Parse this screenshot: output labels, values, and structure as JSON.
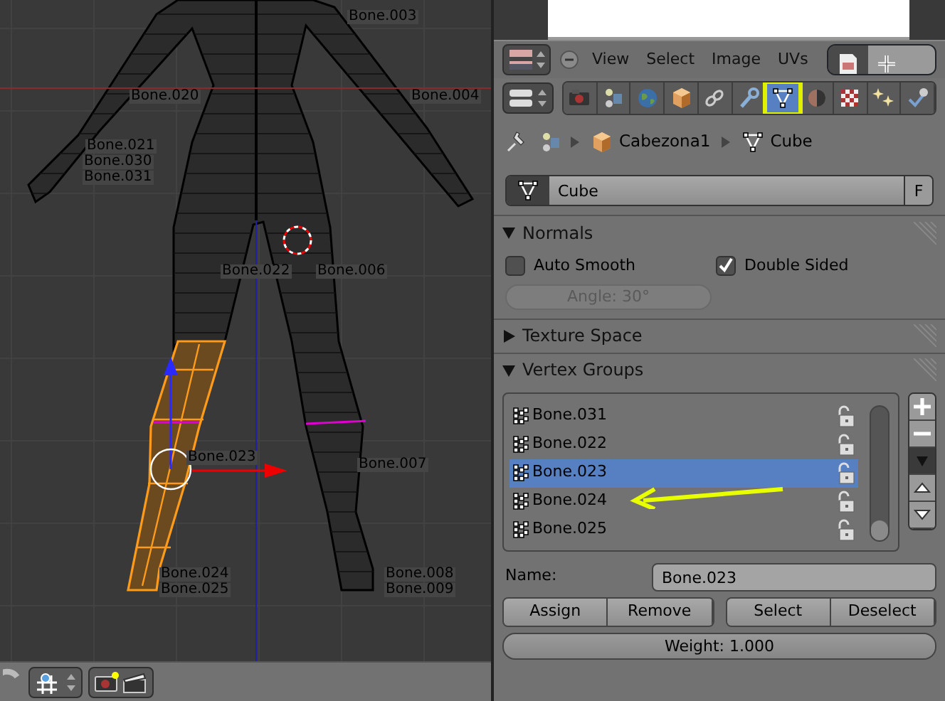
{
  "image_editor": {
    "menus": [
      {
        "label": "View"
      },
      {
        "label": "Select"
      },
      {
        "label": "Image"
      },
      {
        "label": "UVs"
      }
    ]
  },
  "viewport": {
    "bone_labels": [
      "Bone.003",
      "Bone.020",
      "Bone.004",
      "Bone.021",
      "Bone.030",
      "Bone.031",
      "Bone.022",
      "Bone.006",
      "Bone.023",
      "Bone.007",
      "Bone.024",
      "Bone.025",
      "Bone.008",
      "Bone.009"
    ]
  },
  "properties": {
    "tabs": [
      {
        "kind": "render",
        "selected": false
      },
      {
        "kind": "scene",
        "selected": false
      },
      {
        "kind": "world",
        "selected": false
      },
      {
        "kind": "object",
        "selected": false
      },
      {
        "kind": "constraints",
        "selected": false
      },
      {
        "kind": "modifiers",
        "selected": false
      },
      {
        "kind": "data",
        "selected": true
      },
      {
        "kind": "material",
        "selected": false
      },
      {
        "kind": "texture",
        "selected": false
      },
      {
        "kind": "particles",
        "selected": false
      },
      {
        "kind": "physics",
        "selected": false
      }
    ],
    "breadcrumb": [
      {
        "kind": "object",
        "label": "Cabezona1"
      },
      {
        "kind": "mesh",
        "label": "Cube"
      }
    ],
    "datablock": {
      "name": "Cube",
      "fake_user": "F"
    },
    "panels": [
      {
        "kind": "normals",
        "title": "Normals",
        "expanded": true,
        "auto_smooth": {
          "label": "Auto Smooth",
          "checked": false
        },
        "double_sided": {
          "label": "Double Sided",
          "checked": true
        },
        "angle": {
          "label": "Angle: 30°",
          "disabled": true
        }
      },
      {
        "kind": "texture_space",
        "title": "Texture Space",
        "expanded": false
      },
      {
        "kind": "vertex_groups",
        "title": "Vertex Groups",
        "expanded": true,
        "groups": [
          {
            "name": "Bone.031",
            "selected": false
          },
          {
            "name": "Bone.022",
            "selected": false
          },
          {
            "name": "Bone.023",
            "selected": true
          },
          {
            "name": "Bone.024",
            "selected": false
          },
          {
            "name": "Bone.025",
            "selected": false
          }
        ],
        "name_label": "Name:",
        "name_value": "Bone.023",
        "buttons": [
          "Assign",
          "Remove",
          "Select",
          "Deselect"
        ],
        "weight": {
          "label": "Weight: 1.000",
          "level": 1
        }
      }
    ]
  }
}
